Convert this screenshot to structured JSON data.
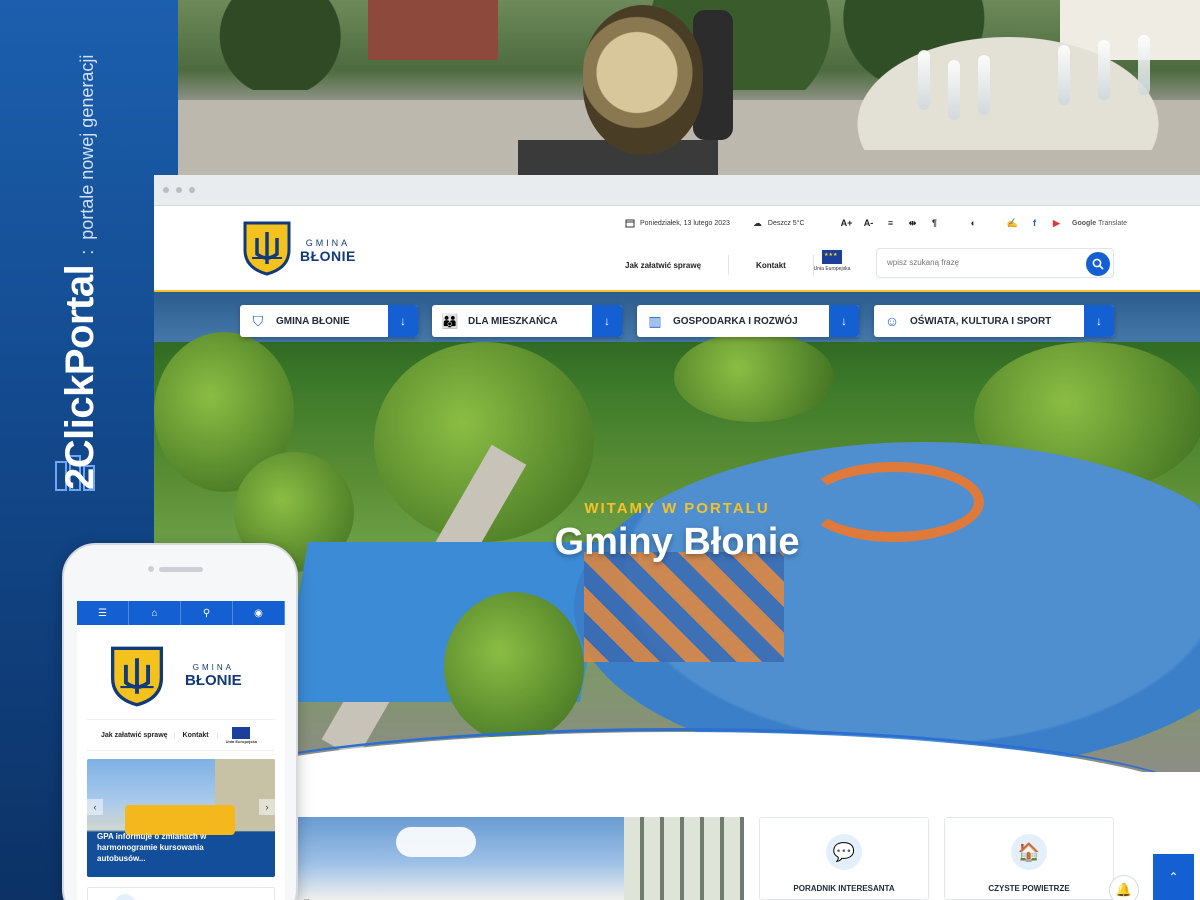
{
  "brand": {
    "name": "2ClickPortal",
    "separator": ":",
    "tagline": "portale nowej generacji"
  },
  "header": {
    "logo_small": "GMINA",
    "logo_big": "BŁONIE",
    "date": "Poniedziałek, 13 lutego 2023",
    "weather": "Deszcz 5°C",
    "font_increase": "A+",
    "font_decrease": "A-",
    "translate_brand": "Google",
    "translate_label": "Translate",
    "links": [
      "Jak załatwić sprawę",
      "Kontakt"
    ],
    "eu_label": "Unia Europejska",
    "search_placeholder": "wpisz szukaną frazę"
  },
  "menu": [
    {
      "label": "GMINA BŁONIE",
      "icon": "shield-icon"
    },
    {
      "label": "DLA MIESZKAŃCA",
      "icon": "people-icon"
    },
    {
      "label": "GOSPODARKA I ROZWÓJ",
      "icon": "chart-icon"
    },
    {
      "label": "OŚWIATA, KULTURA I SPORT",
      "icon": "theater-masks-icon"
    }
  ],
  "hero": {
    "subtitle": "WITAMY W PORTALU",
    "title": "Gminy Błonie"
  },
  "news": {
    "caption": "... "
  },
  "cards": [
    {
      "label": "PORADNIK INTERESANTA",
      "icon": "guide-icon"
    },
    {
      "label": "CZYSTE POWIETRZE",
      "icon": "house-leaf-icon"
    }
  ],
  "mobile": {
    "logo_small": "GMINA",
    "logo_big": "BŁONIE",
    "links": [
      "Jak załatwić sprawę",
      "Kontakt"
    ],
    "eu_label": "Unia Europejska",
    "news_title": "GPA informuje o zmianach w harmonogramie kursowania autobusów..."
  },
  "colors": {
    "primary": "#1460d2",
    "accent_yellow": "#f3c22b",
    "brand_band": "#134a8e"
  }
}
